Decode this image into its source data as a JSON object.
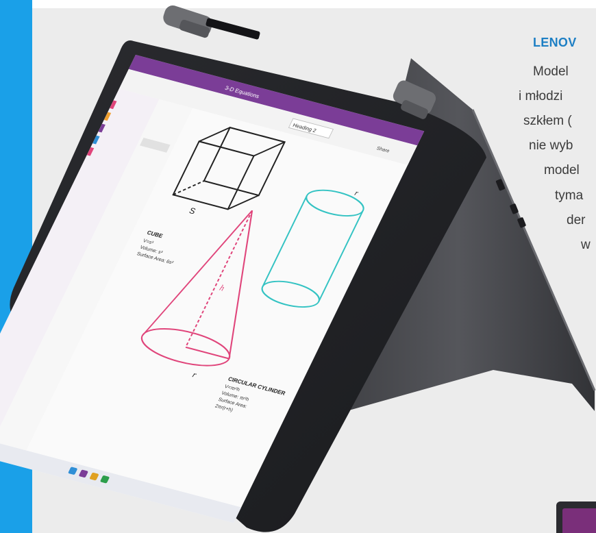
{
  "article": {
    "headline": "LENOV",
    "lines": [
      "Model",
      "i młodzi",
      "szkłem (",
      "nie wyb",
      "model",
      "tyma",
      "der",
      "w"
    ]
  },
  "product_photo": {
    "description_icon": "convertible-laptop-tent-mode",
    "screen": {
      "tab_title": "3-D Equations",
      "style_label": "Heading 2",
      "share_label": "Share",
      "cube": {
        "title": "CUBE",
        "lines": [
          "V=s³",
          "Volume: s³",
          "Surface Area: 6s²"
        ],
        "edge_label": "S"
      },
      "cone": {
        "height_label": "h",
        "radius_label": "r"
      },
      "cylinder": {
        "title": "CIRCULAR CYLINDER",
        "lines": [
          "V=πr²h",
          "Volume: πr²h",
          "Surface Area:",
          "2πr(r+h)"
        ],
        "radius_label": "r"
      }
    },
    "colors": {
      "accent_blue": "#1aa0e8",
      "onenote_purple": "#7b3d97",
      "cone_pink": "#e0457b",
      "cylinder_teal": "#34c3c3"
    }
  }
}
